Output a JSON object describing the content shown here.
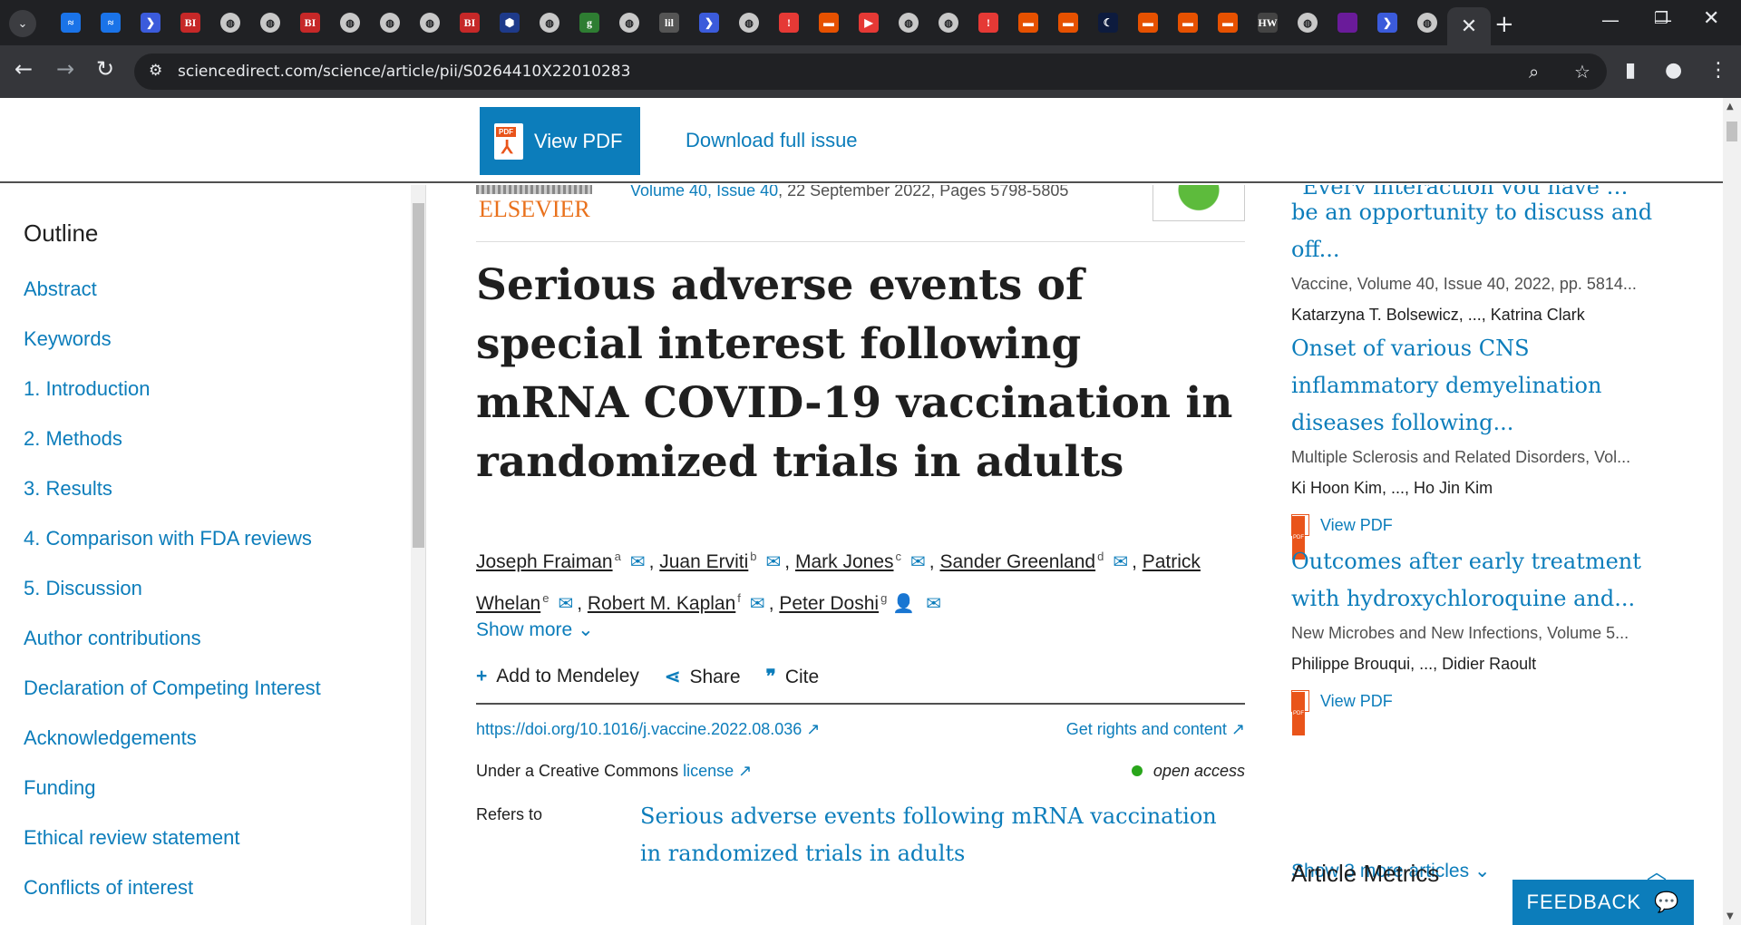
{
  "browser": {
    "url": "sciencedirect.com/science/article/pii/S0264410X22010283",
    "tab_favicons": [
      "wave-icon",
      "wave-icon",
      "readwise-icon",
      "BI",
      "globe-icon",
      "globe-icon",
      "BI",
      "globe-icon",
      "globe-icon",
      "globe-icon",
      "BI",
      "hex-icon",
      "globe-icon",
      "g",
      "globe-icon",
      "lil",
      "readwise-icon",
      "globe-icon",
      "alert-icon",
      "bookmark-icon",
      "youtube-icon",
      "globe-icon",
      "globe-icon",
      "alert-icon",
      "bookmark-icon",
      "bookmark-icon",
      "moon-icon",
      "bookmark-icon",
      "bookmark-icon",
      "bookmark-icon",
      "HW",
      "globe-icon",
      "purple-icon",
      "readwise-icon",
      "globe-icon"
    ],
    "active_tab_close": "✕",
    "new_tab": "+"
  },
  "sticky": {
    "view_pdf": "View PDF",
    "pdf_label": "PDF",
    "download_issue": "Download full issue"
  },
  "outline": {
    "title": "Outline",
    "items": [
      "Abstract",
      "Keywords",
      "1. Introduction",
      "2. Methods",
      "3. Results",
      "4. Comparison with FDA reviews",
      "5. Discussion",
      "Author contributions",
      "Declaration of Competing Interest",
      "Acknowledgements",
      "Funding",
      "Ethical review statement",
      "Conflicts of interest"
    ]
  },
  "article": {
    "publisher": "ELSEVIER",
    "volume_link": "Volume 40, Issue 40",
    "volume_rest": ", 22 September 2022, Pages 5798-5805",
    "title": "Serious adverse events of special interest following mRNA COVID-19 vaccination in randomized trials in adults",
    "authors": [
      {
        "name": "Joseph Fraiman",
        "sup": "a"
      },
      {
        "name": "Juan Erviti",
        "sup": "b"
      },
      {
        "name": "Mark Jones",
        "sup": "c"
      },
      {
        "name": "Sander Greenland",
        "sup": "d"
      },
      {
        "name": "Patrick Whelan",
        "sup": "e"
      },
      {
        "name": "Robert M. Kaplan",
        "sup": "f"
      },
      {
        "name": "Peter Doshi",
        "sup": "g"
      }
    ],
    "show_more": "Show more",
    "add_mendeley": "Add to Mendeley",
    "share": "Share",
    "cite": "Cite",
    "doi": "https://doi.org/10.1016/j.vaccine.2022.08.036",
    "rights": "Get rights and content",
    "license_prefix": "Under a Creative Commons",
    "license_link": "license",
    "open_access": "open access",
    "refers_label": "Refers to",
    "refers_title": "Serious adverse events following mRNA vaccination in randomized trials in adults"
  },
  "recommended": {
    "items": [
      {
        "title_top": "“Every interaction you have …should",
        "title": "be an opportunity to discuss and off...",
        "meta": "Vaccine, Volume 40, Issue 40, 2022, pp. 5814...",
        "authors": "Katarzyna T. Bolsewicz, ..., Katrina Clark"
      },
      {
        "title": "Onset of various CNS inflammatory demyelination diseases following...",
        "meta": "Multiple Sclerosis and Related Disorders, Vol...",
        "authors": "Ki Hoon Kim, ..., Ho Jin Kim",
        "pdf": "View PDF"
      },
      {
        "title": "Outcomes after early treatment with hydroxychloroquine and...",
        "meta": "New Microbes and New Infections, Volume 5...",
        "authors": "Philippe Brouqui, ..., Didier Raoult",
        "pdf": "View PDF"
      }
    ],
    "show_more": "Show 3 more articles",
    "metrics": "Article Metrics"
  },
  "feedback": "FEEDBACK"
}
